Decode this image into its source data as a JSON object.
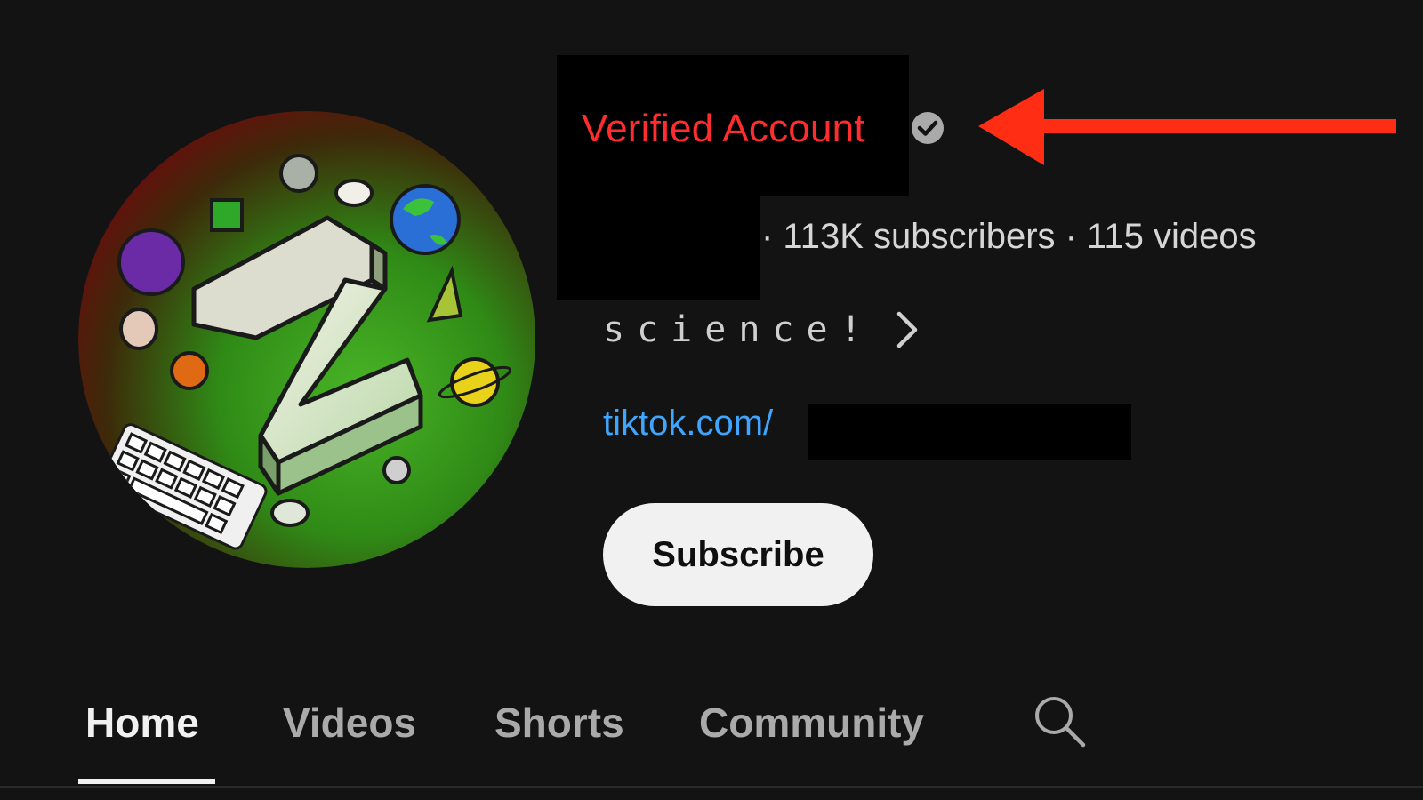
{
  "annotation": {
    "label": "Verified Account",
    "label_color": "#ff2d2d",
    "arrow_color": "#ff2d14"
  },
  "channel": {
    "stats": "· 113K subscribers · 115 videos",
    "description": "science!",
    "link": "tiktok.com/",
    "verified_icon": "verified-check-icon",
    "avatar_letter": "Z"
  },
  "actions": {
    "subscribe_label": "Subscribe"
  },
  "tabs": [
    {
      "label": "Home",
      "active": true
    },
    {
      "label": "Videos",
      "active": false
    },
    {
      "label": "Shorts",
      "active": false
    },
    {
      "label": "Community",
      "active": false
    }
  ],
  "icons": {
    "search": "search-icon",
    "chevron": "chevron-right-icon"
  },
  "colors": {
    "background": "#131313",
    "link": "#3ea6ff",
    "subscribe_bg": "#f1f1f1",
    "tab_active": "#f1f1f1",
    "tab_inactive": "#aaaaaa"
  }
}
